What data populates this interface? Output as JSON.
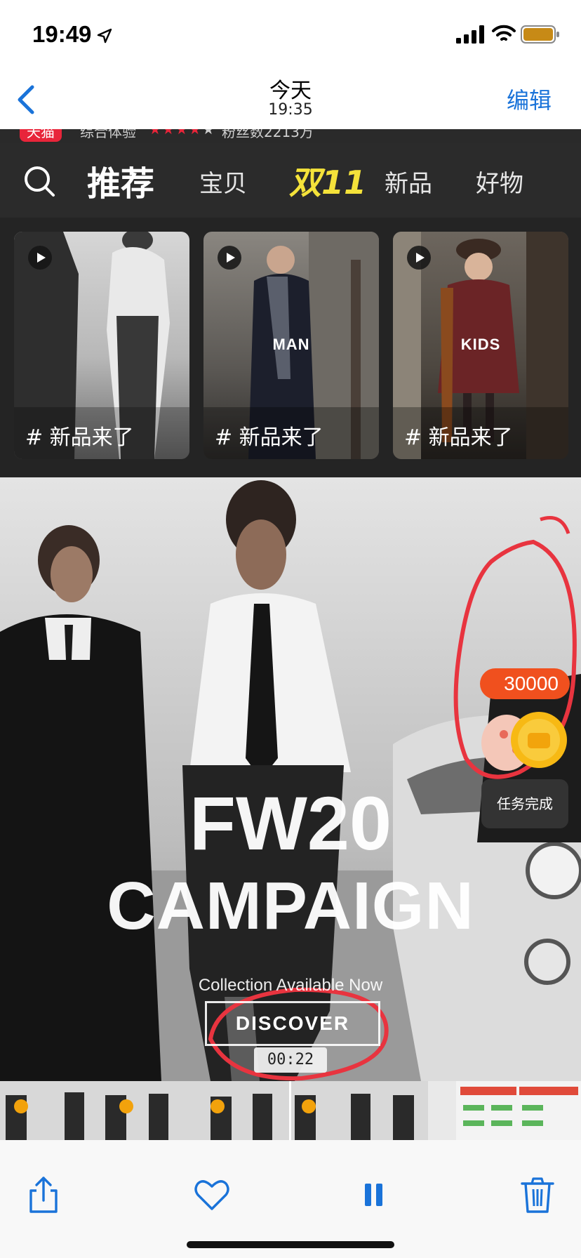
{
  "status_bar": {
    "time": "19:49"
  },
  "nav": {
    "title": "今天",
    "subtitle": "19:35",
    "edit_label": "编辑"
  },
  "store": {
    "badge": "天猫",
    "experience_label": "综合体验",
    "fans_label": "粉丝数2213万"
  },
  "tabs": [
    {
      "label": "推荐",
      "active": true
    },
    {
      "label": "宝贝"
    },
    {
      "label": "双11",
      "highlight_color": "#f4e23a"
    },
    {
      "label": "新品"
    },
    {
      "label": "好物"
    }
  ],
  "video_cards": [
    {
      "overlay": "",
      "tag": "# 新品来了"
    },
    {
      "overlay": "MAN",
      "tag": "# 新品来了"
    },
    {
      "overlay": "KIDS",
      "tag": "# 新品来了"
    }
  ],
  "hero": {
    "title_line1": "FW20",
    "title_line2": "CAMPAIGN",
    "subtitle": "Collection Available Now",
    "button_label": "DISCOVER",
    "video_time": "00:22"
  },
  "reward": {
    "amount": "30000",
    "task_label": "任务完成"
  },
  "toolbar": {
    "icons": [
      "share-icon",
      "heart-icon",
      "pause-icon",
      "trash-icon"
    ]
  },
  "colors": {
    "accent_blue": "#1a73d9",
    "annotation_red": "#e8343f",
    "reward_orange": "#f0501e"
  }
}
